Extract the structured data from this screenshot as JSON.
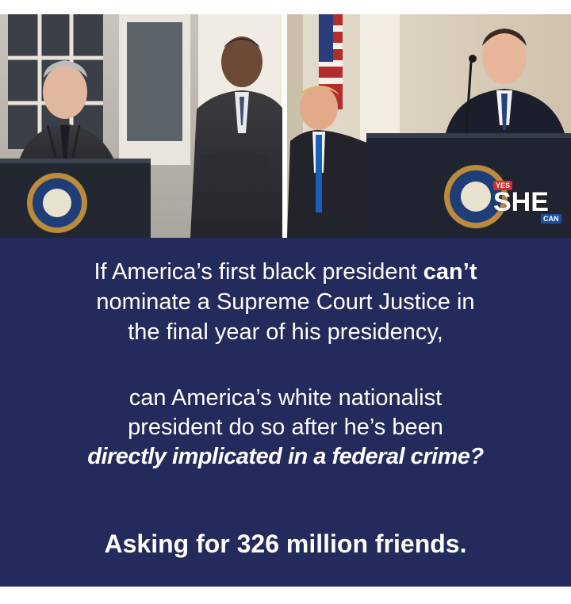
{
  "message": {
    "para1": {
      "line1_prefix": "If America’s first black president ",
      "line1_bold": "can’t",
      "line2": "nominate a Supreme Court Justice in",
      "line3": "the final year of his presidency,"
    },
    "para2": {
      "line1": "can America’s white nationalist",
      "line2": "president do so after he’s been",
      "line3_bold_italic": "directly implicated in a federal crime?"
    },
    "closing": "Asking for 326 million friends."
  },
  "logo": {
    "yes": "YES",
    "she": "SHE",
    "can": "CAN"
  },
  "colors": {
    "background": "#232a5c",
    "text": "#ffffff",
    "logo_red": "#d62b2b",
    "logo_blue": "#1d4f9c"
  }
}
